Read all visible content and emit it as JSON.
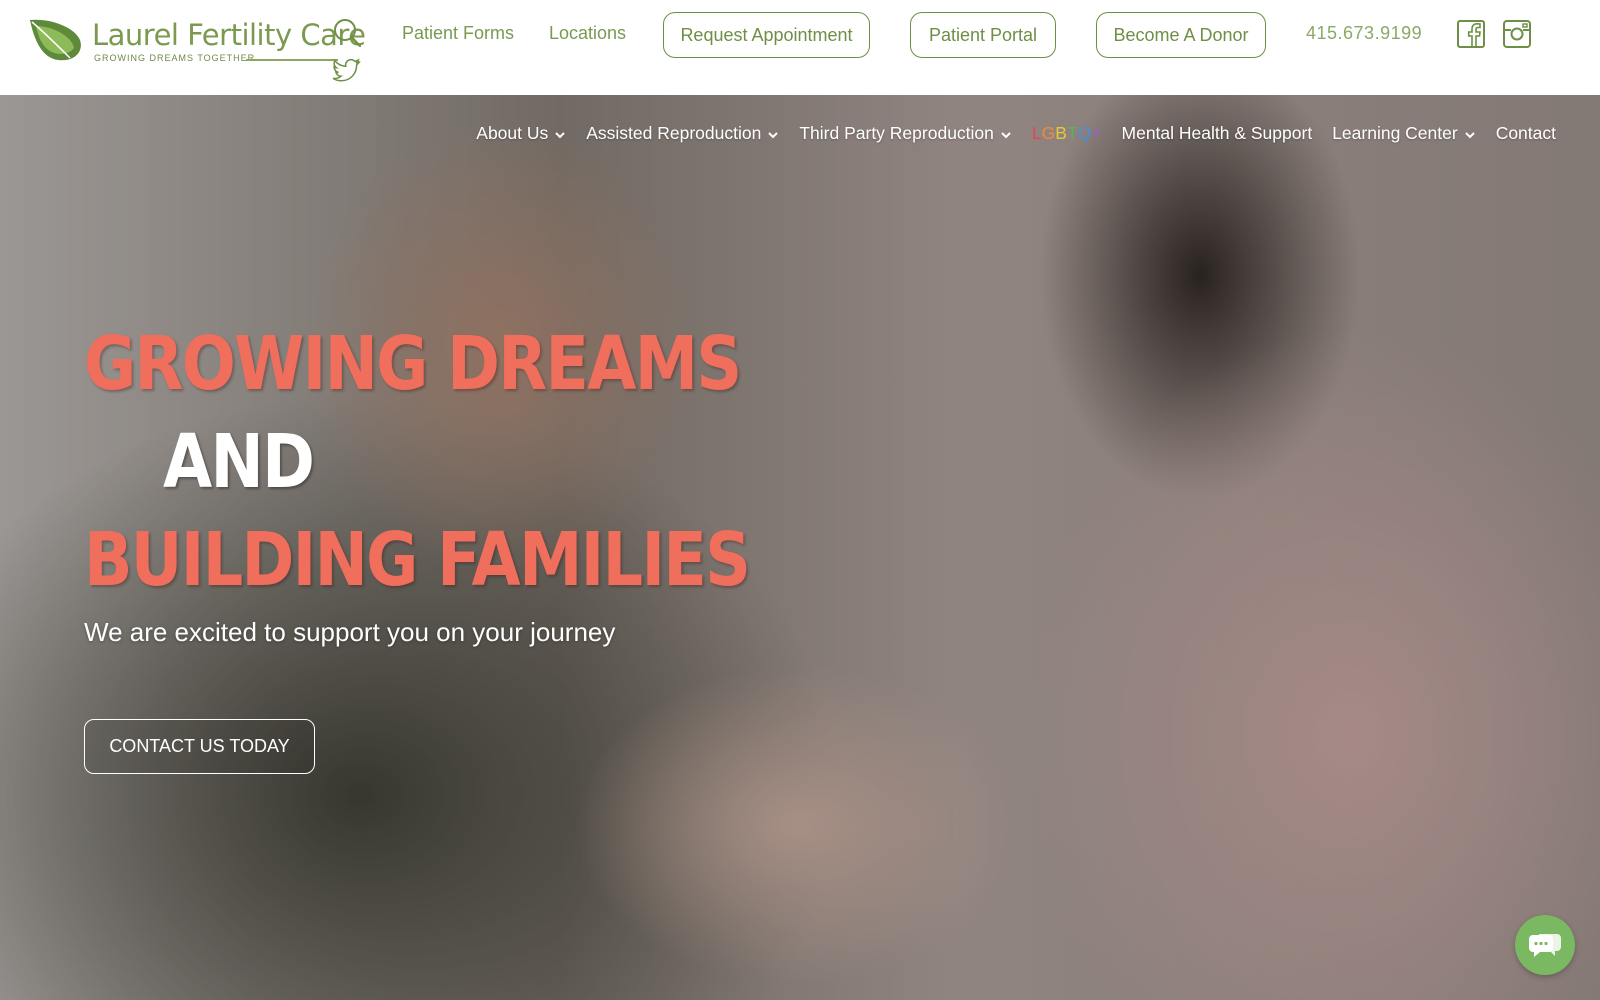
{
  "header": {
    "logo": {
      "name": "Laurel Fertility Care",
      "tagline": "GROWING DREAMS TOGETHER"
    },
    "icons": {
      "search": "search-icon",
      "twitter": "twitter-icon",
      "facebook": "facebook-icon",
      "instagram": "instagram-icon"
    },
    "links": {
      "patient_forms": "Patient Forms",
      "locations": "Locations"
    },
    "buttons": {
      "request_appointment": "Request Appointment",
      "patient_portal": "Patient Portal",
      "become_donor": "Become A Donor"
    },
    "phone": "415.673.9199",
    "colors": {
      "brand_green": "#6e8f45"
    }
  },
  "nav": {
    "items": [
      {
        "label": "About Us",
        "has_dropdown": true
      },
      {
        "label": "Assisted Reproduction",
        "has_dropdown": true
      },
      {
        "label": "Third Party Reproduction",
        "has_dropdown": true
      },
      {
        "label": "LGBTQ+",
        "has_dropdown": false
      },
      {
        "label": "Mental Health & Support",
        "has_dropdown": false
      },
      {
        "label": "Learning Center",
        "has_dropdown": true
      },
      {
        "label": "Contact",
        "has_dropdown": false
      }
    ],
    "lgbt_colors": [
      "#e5484d",
      "#f08a3b",
      "#e6c93a",
      "#58b35a",
      "#4a8fd8",
      "#9b5fc7",
      "#e5a03a"
    ]
  },
  "hero": {
    "line1": "GROWING DREAMS",
    "line2": "AND",
    "line3": "BUILDING FAMILIES",
    "subtitle": "We are excited to support you on your journey",
    "cta": "CONTACT US TODAY",
    "colors": {
      "headline_coral": "#f06e5c"
    }
  },
  "chat": {
    "icon": "chat-bubbles-icon",
    "color": "#7bb862"
  }
}
